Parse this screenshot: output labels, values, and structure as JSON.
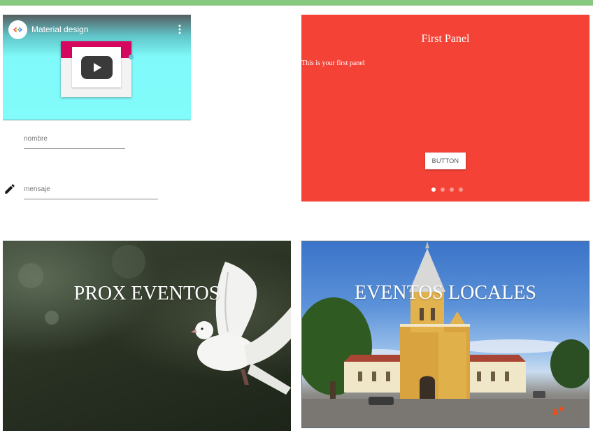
{
  "video": {
    "title": "Material design"
  },
  "form": {
    "name_label": "nombre",
    "message_label": "mensaje"
  },
  "carousel": {
    "panel_title": "First Panel",
    "panel_text": "This is your first panel",
    "button_label": "BUTTON",
    "dots_count": 4,
    "active_dot": 0
  },
  "cards": [
    {
      "title": "PROX EVENTOS"
    },
    {
      "title": "EVENTOS LOCALES"
    }
  ],
  "colors": {
    "top_bar": "#86c97f",
    "panel_bg": "#f44336",
    "video_accent": "#d5075f"
  }
}
